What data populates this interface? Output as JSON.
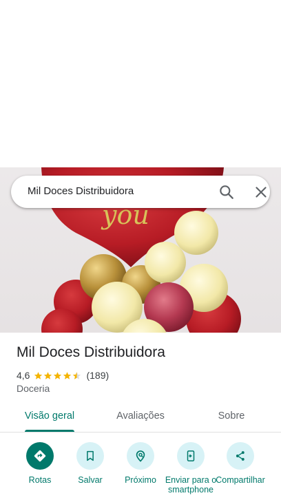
{
  "search": {
    "query": "Mil Doces Distribuidora"
  },
  "hero_image": {
    "description_icon": "balloon-photo",
    "balloon_text": "you"
  },
  "place": {
    "title": "Mil Doces Distribuidora",
    "rating": "4,6",
    "stars": 4.5,
    "review_count": "(189)",
    "category": "Doceria"
  },
  "tabs": [
    {
      "label": "Visão geral",
      "active": true
    },
    {
      "label": "Avaliações",
      "active": false
    },
    {
      "label": "Sobre",
      "active": false
    }
  ],
  "actions": [
    {
      "label": "Rotas",
      "icon": "directions-icon"
    },
    {
      "label": "Salvar",
      "icon": "bookmark-icon"
    },
    {
      "label": "Próximo",
      "icon": "nearby-icon"
    },
    {
      "label": "Enviar para o smartphone",
      "icon": "send-to-phone-icon"
    },
    {
      "label": "Compartilhar",
      "icon": "share-icon"
    }
  ],
  "colors": {
    "accent": "#00796b",
    "action_bg": "#d7f2f6",
    "star": "#f4b400"
  }
}
